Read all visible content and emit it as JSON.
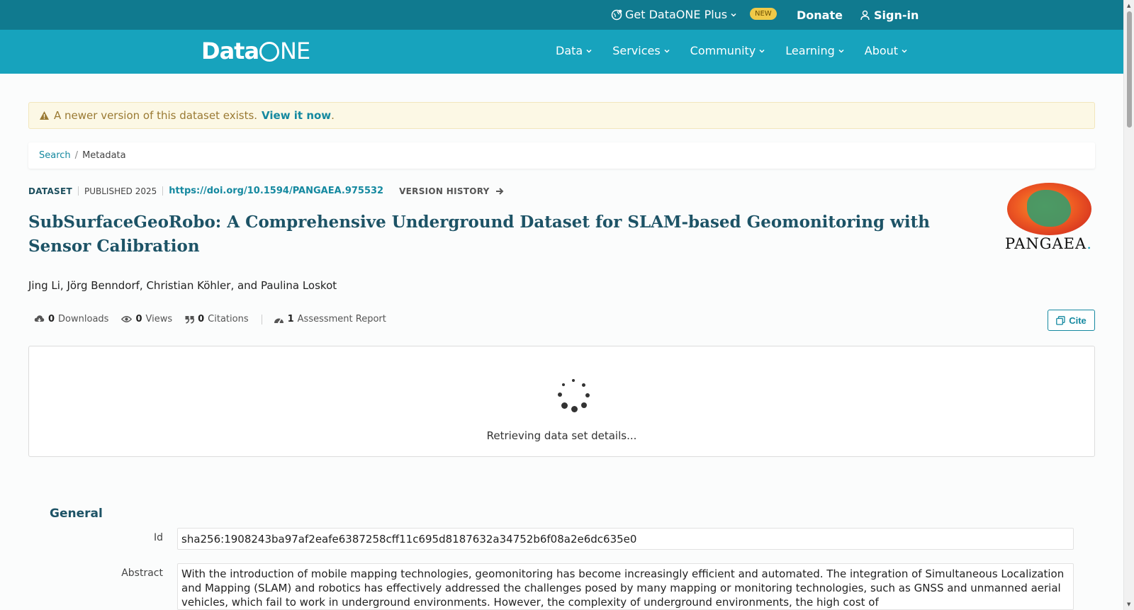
{
  "topbar": {
    "plus_label": "Get DataONE Plus",
    "new_badge": "NEW",
    "donate_label": "Donate",
    "signin_label": "Sign-in"
  },
  "nav": {
    "logo_left": "Data",
    "logo_right": "NE",
    "items": [
      "Data",
      "Services",
      "Community",
      "Learning",
      "About"
    ]
  },
  "alert": {
    "text": "A newer version of this dataset exists.",
    "link": "View it now",
    "suffix": "."
  },
  "breadcrumb": {
    "search": "Search",
    "separator": "/",
    "current": "Metadata"
  },
  "meta": {
    "type": "DATASET",
    "published": "PUBLISHED 2025",
    "doi": "https://doi.org/10.1594/PANGAEA.975532",
    "version_history": "VERSION HISTORY"
  },
  "dataset": {
    "title": "SubSurfaceGeoRobo: A Comprehensive Underground Dataset for SLAM-based Geomonitoring with Sensor Calibration",
    "authors": "Jing Li, Jörg Benndorf, Christian Köhler, and Paulina Loskot"
  },
  "repository": {
    "name": "PANGAEA",
    "dot": "."
  },
  "stats": {
    "downloads_count": "0",
    "downloads_label": "Downloads",
    "views_count": "0",
    "views_label": "Views",
    "citations_count": "0",
    "citations_label": "Citations",
    "assessment_count": "1",
    "assessment_label": "Assessment Report"
  },
  "cite_label": "Cite",
  "loading_message": "Retrieving data set details...",
  "general": {
    "heading": "General",
    "id_label": "Id",
    "id_value": "sha256:1908243ba97af2eafe6387258cff11c695d8187632a34752b6f08a2e6dc635e0",
    "abstract_label": "Abstract",
    "abstract_value": "With the introduction of mobile mapping technologies, geomonitoring has become increasingly efficient and automated. The integration of Simultaneous Localization and Mapping (SLAM) and robotics has effectively addressed the challenges posed by many mapping or monitoring technologies, such as GNSS and unmanned aerial vehicles, which fail to work in underground environments. However, the complexity of underground environments, the high cost of"
  },
  "colors": {
    "topbar": "#107a8f",
    "navbar": "#17a3bd",
    "accent": "#1589a0",
    "title": "#1d5366",
    "alert_bg": "#fcf8e5"
  }
}
